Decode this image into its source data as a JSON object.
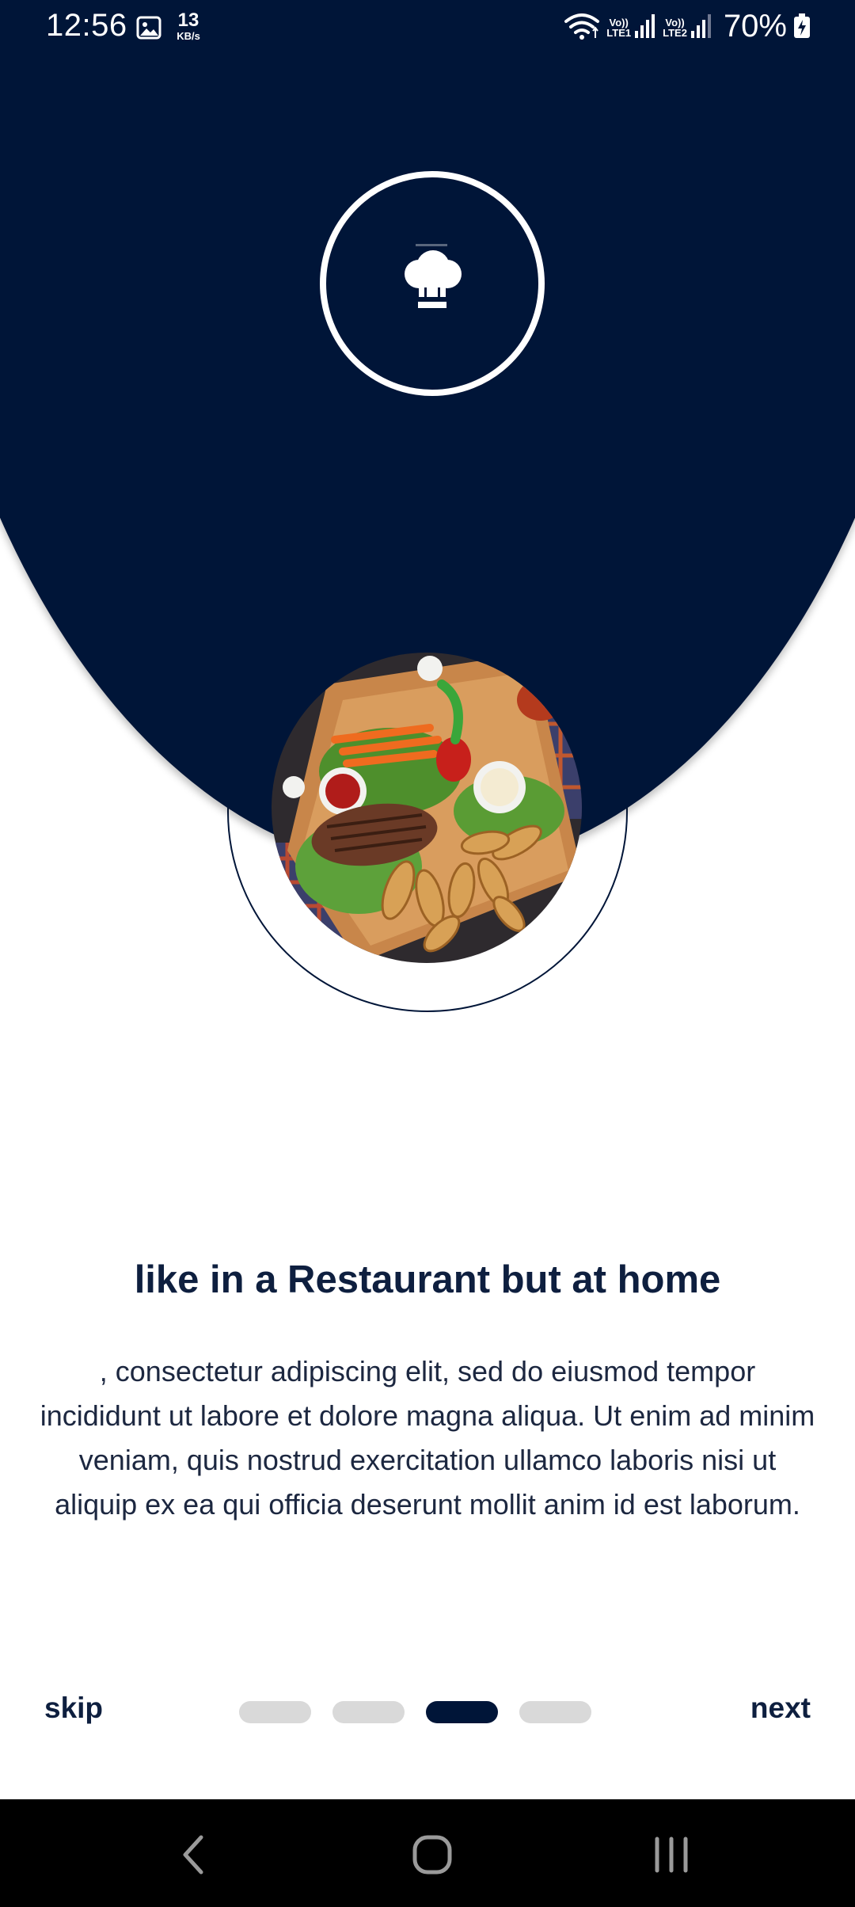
{
  "status_bar": {
    "time": "12:56",
    "speed_value": "13",
    "speed_unit": "KB/s",
    "sim1_label_top": "Vo))",
    "sim1_label_bottom": "LTE1",
    "sim2_label_top": "Vo))",
    "sim2_label_bottom": "LTE2",
    "battery": "70%"
  },
  "onboarding": {
    "title": "like in a Restaurant but at home",
    "description": ", consectetur adipiscing elit, sed do eiusmod tempor incididunt ut labore et dolore magna aliqua. Ut enim ad minim veniam, quis nostrud exercitation ullamco laboris nisi ut aliquip ex ea qui officia deserunt mollit anim id est laborum.",
    "skip_label": "skip",
    "next_label": "next",
    "page_count": 4,
    "active_page": 3
  },
  "colors": {
    "primary": "#001538",
    "dot_inactive": "#d9d9d9",
    "background": "#ffffff"
  },
  "icons": {
    "logo": "chef-hat-icon",
    "nav_back": "back-chevron-icon",
    "nav_home": "home-icon",
    "nav_recents": "recents-icon"
  }
}
